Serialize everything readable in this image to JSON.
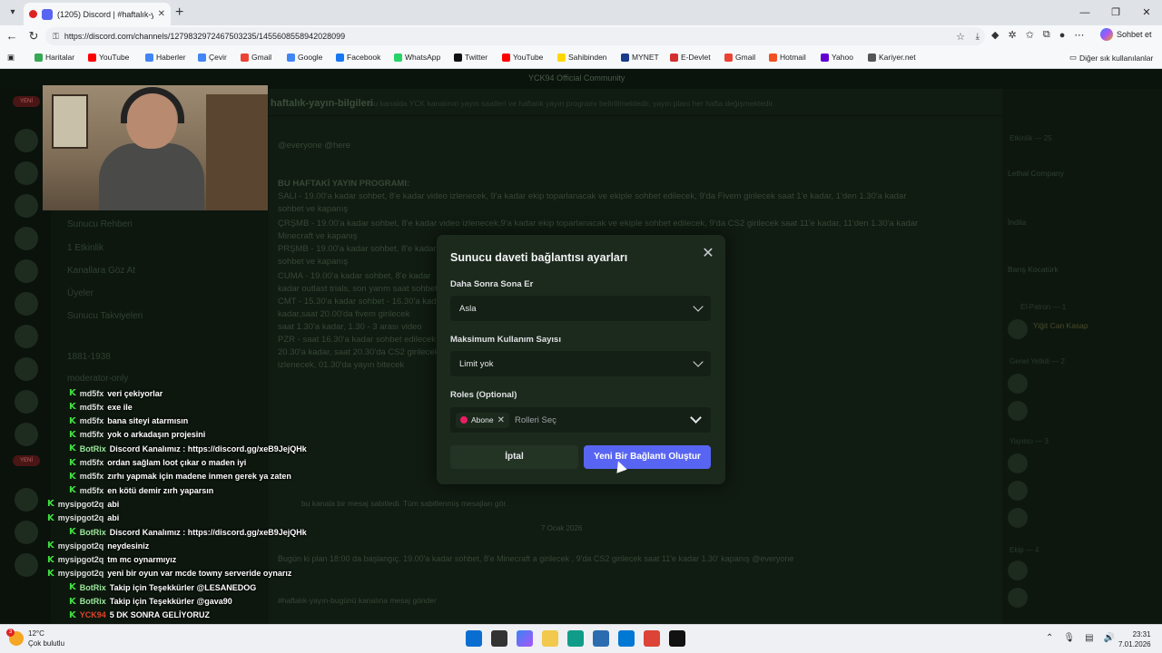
{
  "browser": {
    "tab_title": "(1205) Discord | #haftalık-yayı",
    "url": "https://discord.com/channels/1279832972467503235/1455608558942028099",
    "sign_in_label": "Sohbet et",
    "bookmarks": [
      {
        "label": "Haritalar",
        "color": "#34a853"
      },
      {
        "label": "YouTube",
        "color": "#ff0000"
      },
      {
        "label": "Haberler",
        "color": "#4285f4"
      },
      {
        "label": "Çevir",
        "color": "#4285f4"
      },
      {
        "label": "Gmail",
        "color": "#ea4335"
      },
      {
        "label": "Google",
        "color": "#4285f4"
      },
      {
        "label": "Facebook",
        "color": "#1877f2"
      },
      {
        "label": "WhatsApp",
        "color": "#25d366"
      },
      {
        "label": "Twitter",
        "color": "#111111"
      },
      {
        "label": "YouTube",
        "color": "#ff0000"
      },
      {
        "label": "Sahibinden",
        "color": "#ffd700"
      },
      {
        "label": "MYNET",
        "color": "#1a3a8a"
      },
      {
        "label": "E-Devlet",
        "color": "#d32f2f"
      },
      {
        "label": "Gmail",
        "color": "#ea4335"
      },
      {
        "label": "Hotmail",
        "color": "#f25022"
      },
      {
        "label": "Yahoo",
        "color": "#6001d2"
      },
      {
        "label": "Kariyer.net",
        "color": "#555555"
      }
    ],
    "other_bookmarks": "Diğer sık kullanılanlar"
  },
  "discord": {
    "server_title": "YCK94 Official Community",
    "channel_name": "haftalık-yayın-bilgileri",
    "channel_topic": "Bu kanalda YCK kanalının yayın saatleri ve haftalık yayın programı belirtilmektedir, yayın planı her hafta değişmektedir.",
    "sidebar_items": [
      "Sunucu Rehberi",
      "1 Etkinlik",
      "Kanallara Göz At",
      "Üyeler",
      "Sunucu Takviyeleri",
      "1881-1938",
      "moderator-only"
    ],
    "message_lines": [
      "@everyone @here",
      "BU HAFTAKİ YAYIN PROGRAMI:",
      "SALI - 19.00'a kadar sohbet, 8'e kadar video izlenecek, 9'a kadar ekip toparlanacak ve ekiple sohbet edilecek, 9'da Fivem girilecek saat 1'e kadar, 1'den 1.30'a kadar",
      "sohbet ve kapanış",
      "ÇRŞMB - 19.00'a kadar sohbet, 8'e kadar video izlenecek,9'a kadar ekip toparlanacak ve ekiple sohbet edilecek, 9'da CS2 girilecek saat 11'e kadar, 11'den 1.30'a kadar",
      "Minecraft ve kapanış",
      "PRŞMB - 19.00'a kadar sohbet, 8'e kadar",
      "sohbet ve kapanış",
      "CUMA - 19.00'a kadar sohbet, 8'e kadar",
      "kadar outlast trials, son yarım saat sohbet",
      "CMT - 15.30'a kadar sohbet - 16.30'a kadar",
      "kadar,saat 20.00'da fivem girilecek",
      "saat 1.30'a kadar, 1.30 - 3 arası video",
      "PZR - saat 16.30'a kadar sohbet edilecek",
      "20.30'a kadar, saat 20.30'da CS2 girilecek",
      "izlenecek, 01.30'da yayın bitecek"
    ],
    "date_divider": "7 Ocak 2026",
    "pinned_text": "bu kanala bir mesaj sabitledi. Tüm sabitlenmiş mesajları gör.",
    "last_message": "Bugün ki plan 18:00 da başlangıç. 19.00'a kadar sohbet, 8'e Minecraft a girilecek , 9'da CS2 girilecek saat 11'e kadar  1.30' kapanış @everyone",
    "input_placeholder": "#haftalık-yayın-bugünü kanalına mesaj gönder",
    "members": {
      "event_header": "Etkinlik — 25",
      "events": [
        "Lethal Company",
        "İndila",
        "Barış Kocatürk"
      ],
      "patron_header": "El-Patron — 1",
      "patron": "Yiğit Can Kasap",
      "yetkili_header": "Genel Yetkili — 2",
      "yayinci_header": "Yayıncı — 3",
      "ekip_header": "Ekip — 4"
    }
  },
  "modal": {
    "title": "Sunucu daveti bağlantısı ayarları",
    "expire_label": "Daha Sonra Sona Er",
    "expire_value": "Asla",
    "max_uses_label": "Maksimum Kullanım Sayısı",
    "max_uses_value": "Limit yok",
    "roles_label": "Roles (Optional)",
    "role_chip": "Abone",
    "roles_placeholder": "Rolleri Seç",
    "cancel_label": "İptal",
    "create_label": "Yeni Bir Bağlantı Oluştur"
  },
  "twitch_chat": [
    {
      "user": "md5fx",
      "type": "user",
      "msg": "veri çekiyorlar"
    },
    {
      "user": "md5fx",
      "type": "user",
      "msg": "exe ile"
    },
    {
      "user": "md5fx",
      "type": "user",
      "msg": "bana siteyi atarmısın"
    },
    {
      "user": "md5fx",
      "type": "user",
      "msg": "yok o arkadaşın projesini"
    },
    {
      "user": "BotRix",
      "type": "bot",
      "msg": "Discord Kanalımız : https://discord.gg/xeB9JejQHk"
    },
    {
      "user": "md5fx",
      "type": "user",
      "msg": "ordan sağlam loot çıkar o maden iyi"
    },
    {
      "user": "md5fx",
      "type": "user",
      "msg": "zırhı yapmak için madene inmen gerek ya zaten"
    },
    {
      "user": "md5fx",
      "type": "user",
      "msg": "en kötü demir zırh yaparsın"
    },
    {
      "user": "mysipgot2q",
      "type": "user",
      "msg": "abi"
    },
    {
      "user": "mysipgot2q",
      "type": "user",
      "msg": "abi"
    },
    {
      "user": "BotRix",
      "type": "bot",
      "msg": "Discord Kanalımız : https://discord.gg/xeB9JejQHk"
    },
    {
      "user": "mysipgot2q",
      "type": "user",
      "msg": "neydesiniz"
    },
    {
      "user": "mysipgot2q",
      "type": "user",
      "msg": "tm mc oynarmıyız"
    },
    {
      "user": "mysipgot2q",
      "type": "user",
      "msg": "yeni bir oyun var mcde towny serveride oynarız"
    },
    {
      "user": "BotRix",
      "type": "bot",
      "msg": "Takip için Teşekkürler @LESANEDOG"
    },
    {
      "user": "BotRix",
      "type": "bot",
      "msg": "Takip için Teşekkürler @gava90"
    },
    {
      "user": "YCK94",
      "type": "yck",
      "msg": "5 DK SONRA GELİYORUZ"
    }
  ],
  "taskbar": {
    "weather_temp": "12°C",
    "weather_desc": "Çok bulutlu",
    "weather_badge": "3",
    "time": "23:31",
    "date": "7.01.2026"
  }
}
